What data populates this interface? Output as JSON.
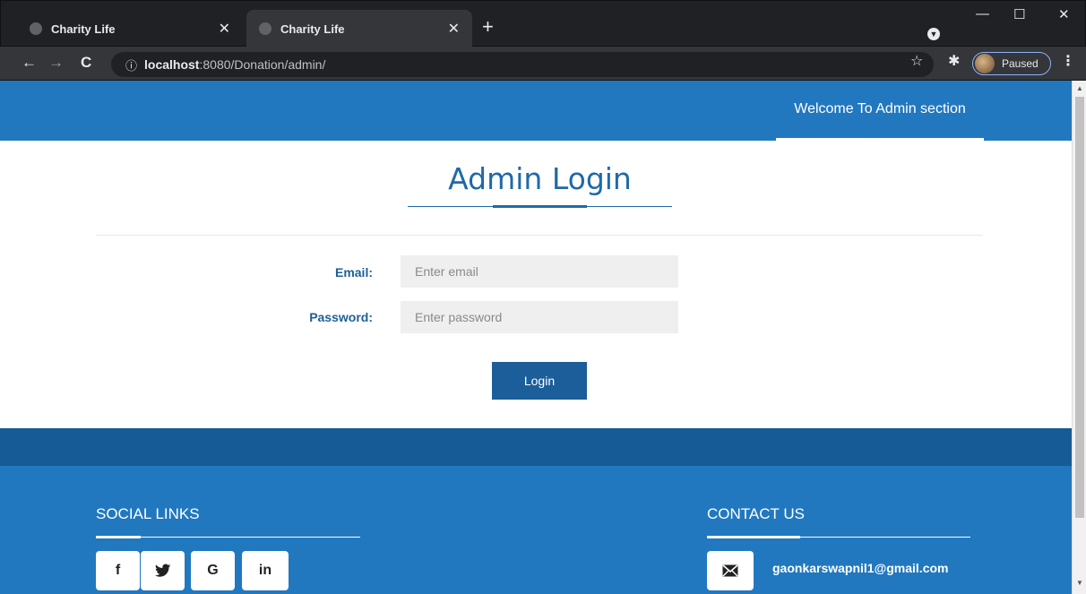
{
  "browser": {
    "tabs": [
      {
        "title": "Charity Life",
        "close": "✕"
      },
      {
        "title": "Charity Life",
        "close": "✕"
      }
    ],
    "new_tab": "+",
    "window_controls": {
      "minimize": "—",
      "maximize": "☐",
      "close": "✕"
    },
    "nav": {
      "back": "←",
      "forward": "→",
      "reload": "C"
    },
    "url": {
      "info": "ⓘ",
      "host": "localhost",
      "path": ":8080/Donation/admin/"
    },
    "bookmark_icon": "☆",
    "extensions_icon": "✱",
    "profile_status": "Paused",
    "menu_icon": "⋮"
  },
  "header": {
    "link": "Welcome To Admin section"
  },
  "login": {
    "title": "Admin Login",
    "email_label": "Email:",
    "email_placeholder": "Enter email",
    "password_label": "Password:",
    "password_placeholder": "Enter password",
    "button": "Login"
  },
  "footer": {
    "social_heading": "SOCIAL LINKS",
    "social": [
      "f",
      "𝕐",
      "G",
      "in"
    ],
    "contact_heading": "CONTACT US",
    "email": "gaonkarswapnil1@gmail.com"
  },
  "colors": {
    "brand_blue": "#2178bf",
    "band_blue": "#165a96",
    "button_blue": "#1b5e99",
    "title_blue": "#1e6aa8"
  }
}
